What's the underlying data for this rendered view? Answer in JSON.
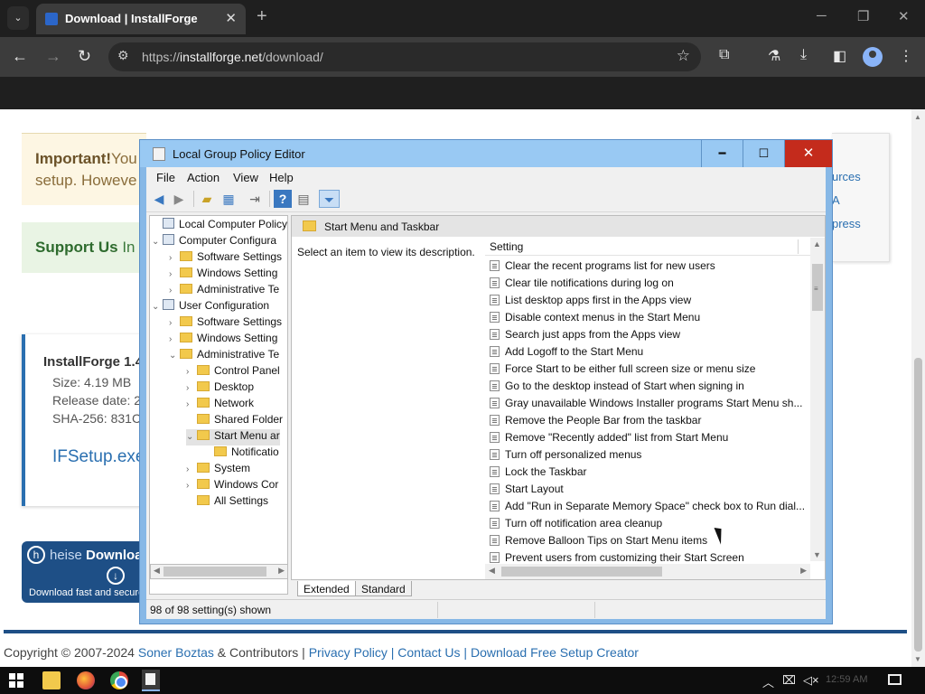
{
  "browser": {
    "tab_title": "Download | InstallForge",
    "url_scheme": "https://",
    "url_host": "installforge.net",
    "url_path": "/download/",
    "icons": [
      "tab-search-icon",
      "close-icon",
      "plus-icon",
      "back-icon",
      "forward-icon",
      "reload-icon",
      "site-info-icon",
      "star-icon",
      "extensions-icon",
      "labs-icon",
      "download-icon",
      "sidepanel-icon",
      "profile-icon",
      "more-icon"
    ]
  },
  "page": {
    "important_bold": "Important!",
    "important_rest": "You",
    "important_line2": "setup. Howeve",
    "support_bold": "Support Us",
    "support_rest": " In",
    "right_links": [
      "urces",
      "A",
      "press"
    ],
    "card_title": "InstallForge 1.4",
    "size": "Size: 4.19 MB",
    "release": "Release date: 2",
    "sha": "SHA-256: 831C",
    "file": "IFSetup.exe",
    "heise_prefix": "heise ",
    "heise_bold": "Download",
    "heise_tag": "Download fast and securel",
    "footer_copyright": "Copyright © 2007-2024 ",
    "footer_author": "Soner Boztas",
    "footer_contrib": " & Contributors | ",
    "footer_privacy": "Privacy Policy",
    "footer_sep": " | ",
    "footer_contact": "Contact Us",
    "footer_free": "Download Free Setup Creator"
  },
  "gpe": {
    "title": "Local Group Policy Editor",
    "menu": [
      "File",
      "Action",
      "View",
      "Help"
    ],
    "tree": [
      {
        "label": "Local Computer Policy",
        "chev": "",
        "icon": "pc"
      },
      {
        "label": "Computer Configura",
        "chev": "⌄",
        "icon": "pc"
      },
      {
        "label": "Software Settings",
        "chev": "›",
        "icon": "folder"
      },
      {
        "label": "Windows Setting",
        "chev": "›",
        "icon": "folder"
      },
      {
        "label": "Administrative Te",
        "chev": "›",
        "icon": "folder"
      },
      {
        "label": "User Configuration",
        "chev": "⌄",
        "icon": "pc"
      },
      {
        "label": "Software Settings",
        "chev": "›",
        "icon": "folder"
      },
      {
        "label": "Windows Setting",
        "chev": "›",
        "icon": "folder"
      },
      {
        "label": "Administrative Te",
        "chev": "⌄",
        "icon": "folder"
      },
      {
        "label": "Control Panel",
        "chev": "›",
        "icon": "folder"
      },
      {
        "label": "Desktop",
        "chev": "›",
        "icon": "folder"
      },
      {
        "label": "Network",
        "chev": "›",
        "icon": "folder"
      },
      {
        "label": "Shared Folder",
        "chev": "",
        "icon": "folder"
      },
      {
        "label": "Start Menu ar",
        "chev": "⌄",
        "icon": "folder"
      },
      {
        "label": "Notificatio",
        "chev": "",
        "icon": "folder"
      },
      {
        "label": "System",
        "chev": "›",
        "icon": "folder"
      },
      {
        "label": "Windows Cor",
        "chev": "›",
        "icon": "folder"
      },
      {
        "label": "All Settings",
        "chev": "",
        "icon": "folder"
      }
    ],
    "pane_title": "Start Menu and Taskbar",
    "description": "Select an item to view its description.",
    "column_setting": "Setting",
    "settings": [
      "Clear the recent programs list for new users",
      "Clear tile notifications during log on",
      "List desktop apps first in the Apps view",
      "Disable context menus in the Start Menu",
      "Search just apps from the Apps view",
      "Add Logoff to the Start Menu",
      "Force Start to be either full screen size or menu size",
      "Go to the desktop instead of Start when signing in",
      "Gray unavailable Windows Installer programs Start Menu sh...",
      "Remove the People Bar from the taskbar",
      "Remove \"Recently added\" list from Start Menu",
      "Turn off personalized menus",
      "Lock the Taskbar",
      "Start Layout",
      "Add \"Run in Separate Memory Space\" check box to Run dial...",
      "Turn off notification area cleanup",
      "Remove Balloon Tips on Start Menu items",
      "Prevent users from customizing their Start Screen"
    ],
    "tab_extended": "Extended",
    "tab_standard": "Standard",
    "status": "98 of 98 setting(s) shown"
  },
  "taskbar": {
    "clock": "12:59 AM"
  }
}
